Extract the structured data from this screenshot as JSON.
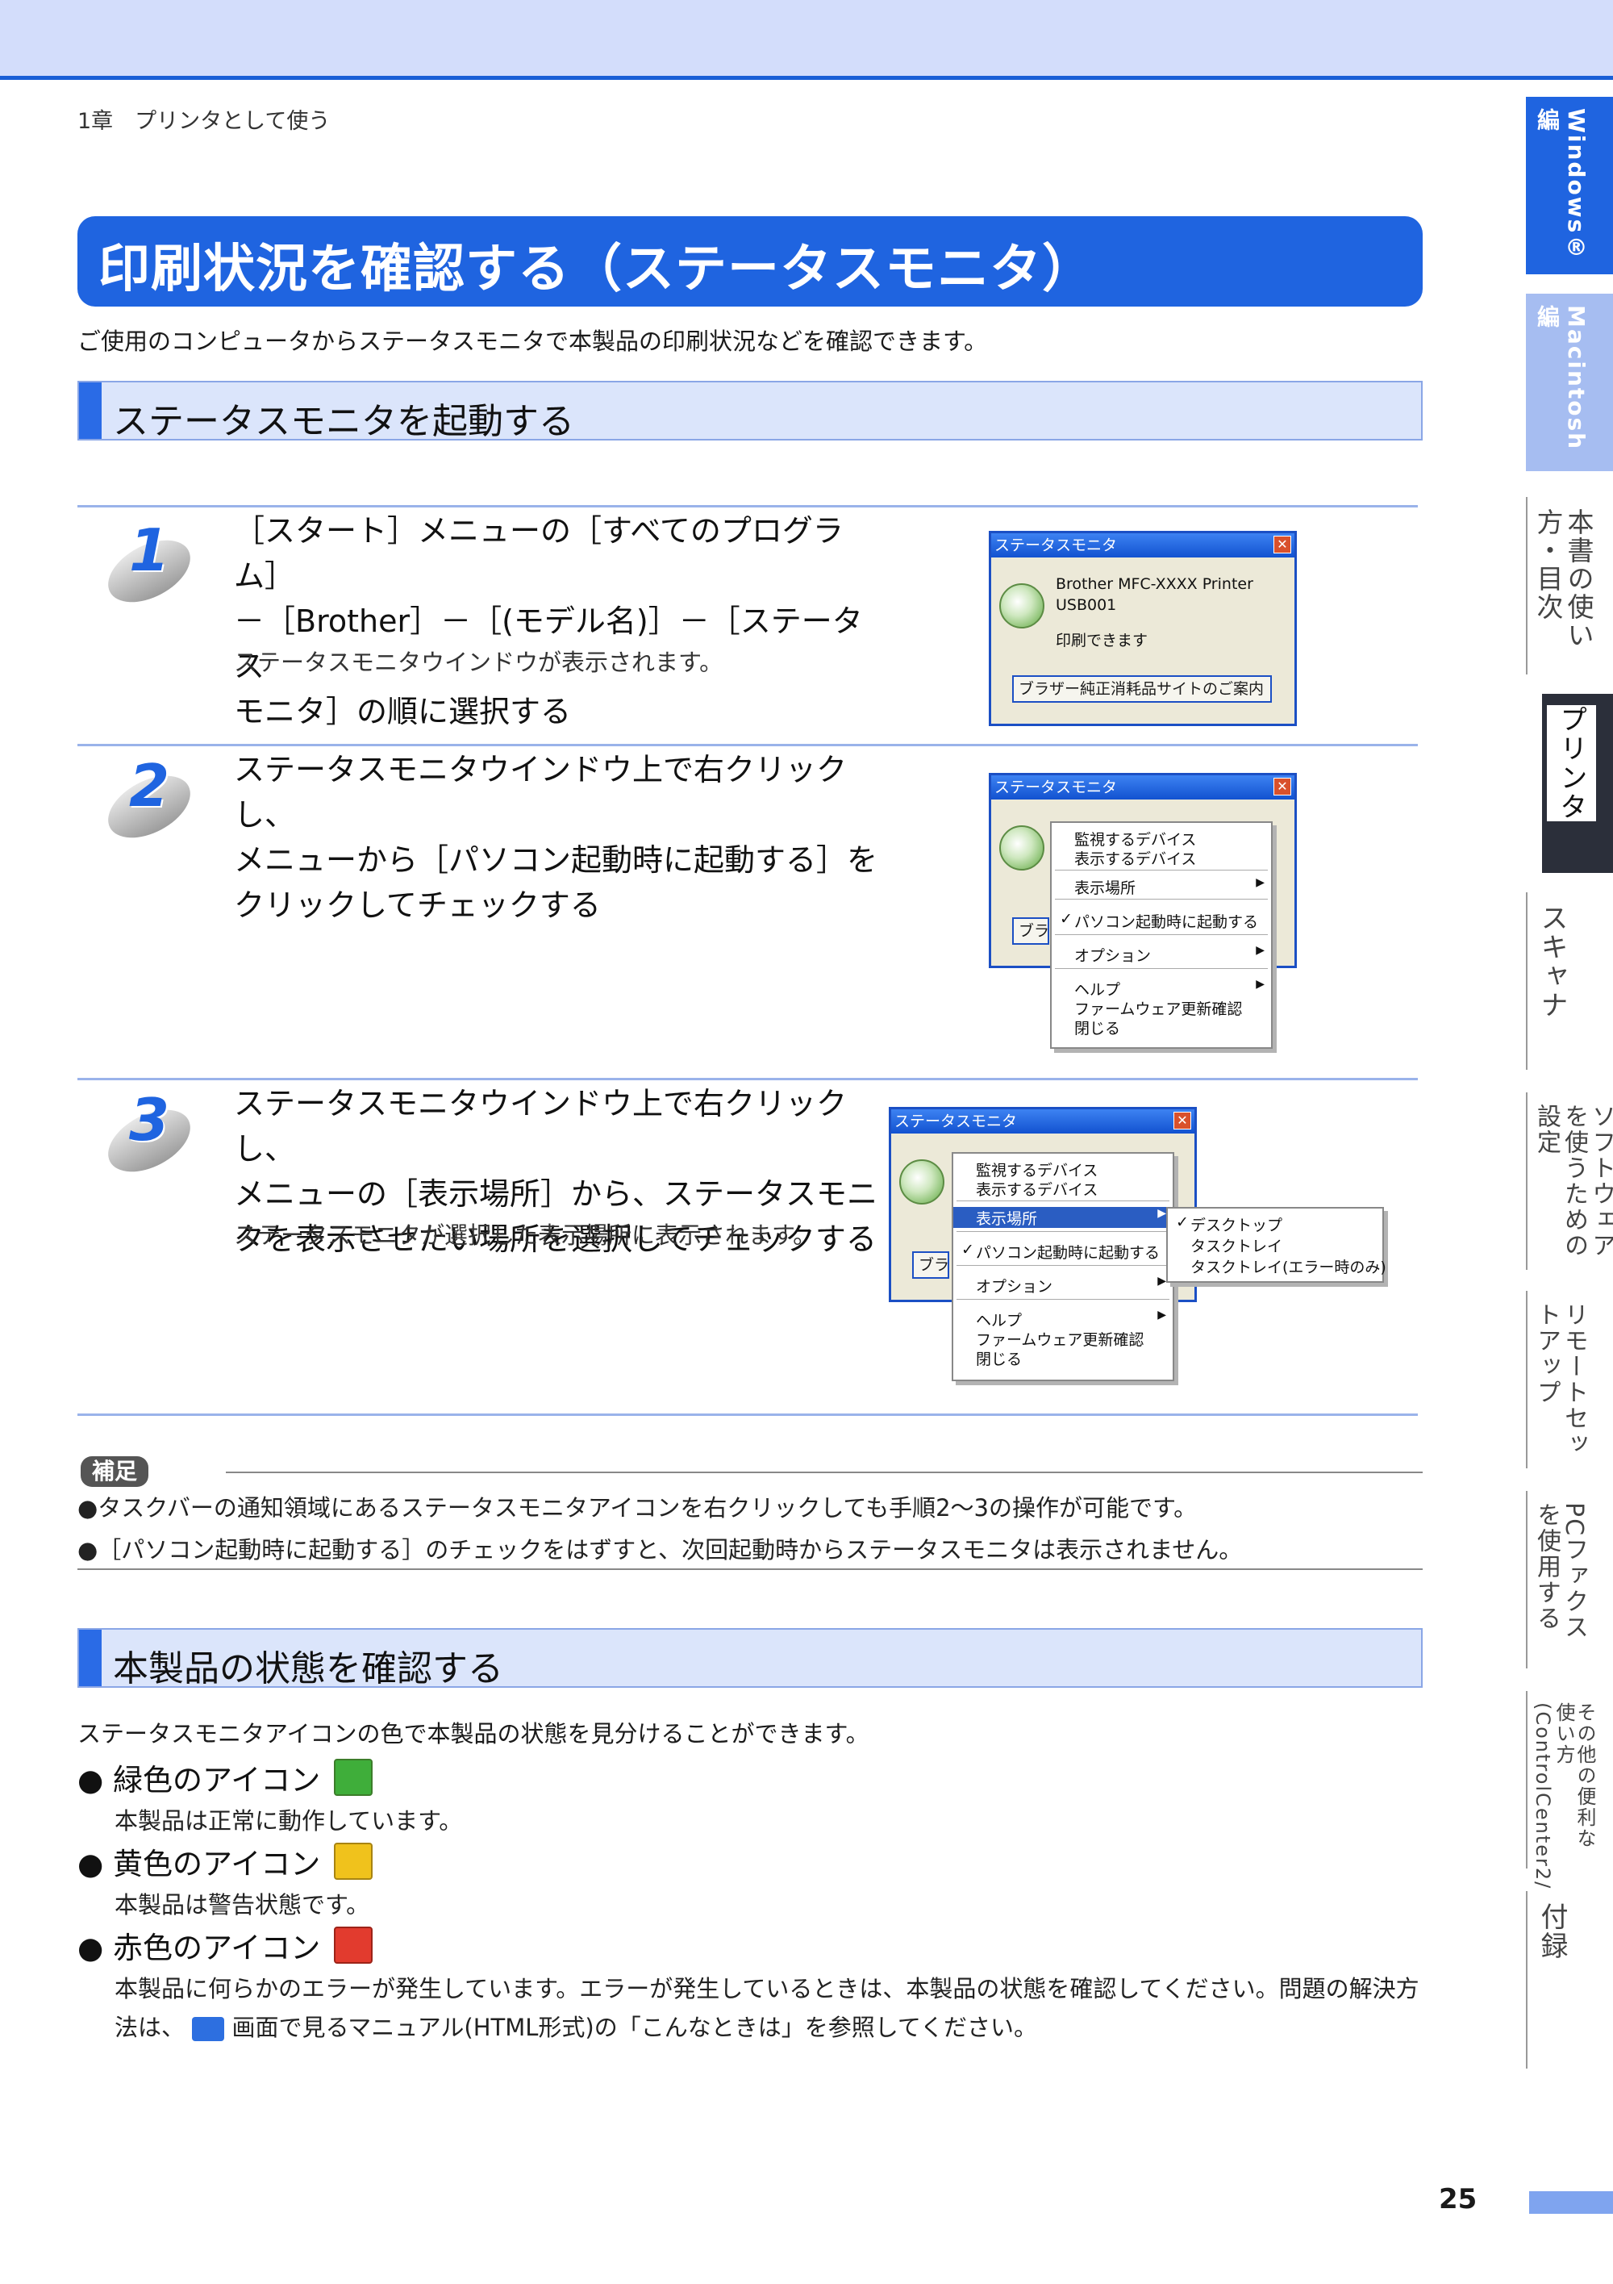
{
  "breadcrumb": "1章　プリンタとして使う",
  "title": "印刷状況を確認する（ステータスモニタ）",
  "intro": "ご使用のコンピュータからステータスモニタで本製品の印刷状況などを確認できます。",
  "section1": "ステータスモニタを起動する",
  "steps": [
    {
      "num": "1",
      "lines": [
        "［スタート］メニューの［すべてのプログラム］",
        "－［Brother］－［(モデル名)］－［ステータス",
        "モニタ］の順に選択する"
      ],
      "note": "ステータスモニタウインドウが表示されます。"
    },
    {
      "num": "2",
      "lines": [
        "ステータスモニタウインドウ上で右クリックし、",
        "メニューから［パソコン起動時に起動する］を",
        "クリックしてチェックする"
      ],
      "note": ""
    },
    {
      "num": "3",
      "lines": [
        "ステータスモニタウインドウ上で右クリックし、",
        "メニューの［表示場所］から、ステータスモニ",
        "タを表示させたい場所を選択してチェックする"
      ],
      "note": "ステータスモニタが選択した表示場所に表示されます。"
    }
  ],
  "window": {
    "title": "ステータスモニタ",
    "close": "✕",
    "device": "Brother MFC-XXXX Printer",
    "port": "USB001",
    "status": "印刷できます",
    "button": "ブラザー純正消耗品サイトのご案内",
    "button_short": "ブラ"
  },
  "context_menu": {
    "items": [
      "監視するデバイス",
      "表示するデバイス",
      "表示場所",
      "パソコン起動時に起動する",
      "オプション",
      "ヘルプ",
      "ファームウェア更新確認",
      "閉じる"
    ],
    "check": "✓",
    "arrow": "▶"
  },
  "submenu": [
    "デスクトップ",
    "タスクトレイ",
    "タスクトレイ(エラー時のみ)"
  ],
  "note": {
    "label": "補足",
    "lines": [
      "●タスクバーの通知領域にあるステータスモニタアイコンを右クリックしても手順2～3の操作が可能です。",
      "●［パソコン起動時に起動する］のチェックをはずすと、次回起動時からステータスモニタは表示されません。"
    ]
  },
  "section2": "本製品の状態を確認する",
  "section2_intro": "ステータスモニタアイコンの色で本製品の状態を見分けることができます。",
  "statuses": [
    {
      "label": "● 緑色のアイコン",
      "desc": "本製品は正常に動作しています。",
      "color": "#3fae3a"
    },
    {
      "label": "● 黄色のアイコン",
      "desc": "本製品は警告状態です。",
      "color": "#f0c21c"
    },
    {
      "label": "● 赤色のアイコン",
      "desc": "本製品に何らかのエラーが発生しています。エラーが発生しているときは、本製品の状態を確認してください。問題の解決方",
      "color": "#e23b2e"
    }
  ],
  "status_desc_line2": "法は、",
  "status_desc_line2b": "画面で見るマニュアル(HTML形式)の「こんなときは」を参照してください。",
  "side_tabs": [
    {
      "label": "Windows®編"
    },
    {
      "label": "Macintosh編"
    },
    {
      "label": "本書の使い方・目次"
    },
    {
      "label": "プリンタ"
    },
    {
      "label": "スキャナ"
    },
    {
      "label": "ソフトウェアを使うための設定"
    },
    {
      "label": "リモートセットアップ"
    },
    {
      "label": "PCファクスを使用する"
    },
    {
      "label": "その他の便利な使い方(ControlCenter2/3)"
    },
    {
      "label": "付録"
    }
  ],
  "page_number": "25",
  "colors": {
    "accent": "#1f64e0",
    "section_bg": "#dbe5fb",
    "tab_dark": "#2b2f3a"
  }
}
